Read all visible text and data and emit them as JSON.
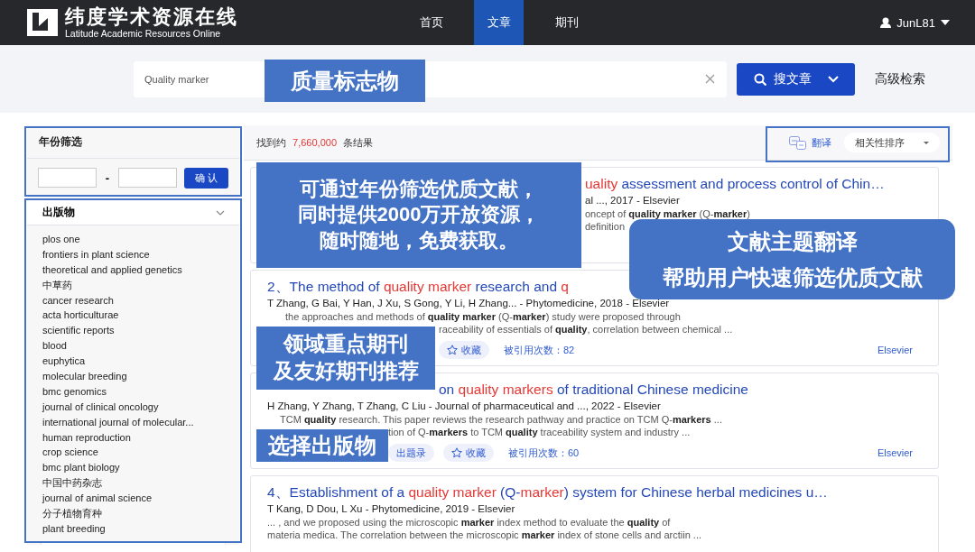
{
  "header": {
    "logo_title": "纬度学术资源在线",
    "logo_subtitle": "Latitude Academic Resources Online",
    "nav": [
      {
        "label": "首页",
        "selected": false
      },
      {
        "label": "文章",
        "selected": true
      },
      {
        "label": "期刊",
        "selected": false
      }
    ],
    "user": "JunL81"
  },
  "search": {
    "query": "Quality marker",
    "button": "搜文章",
    "advanced": "高级检索"
  },
  "year_filter": {
    "title": "年份筛选",
    "separator": "-",
    "button": "确 认"
  },
  "publications": {
    "title": "出版物",
    "items": [
      "plos one",
      "frontiers in plant science",
      "theoretical and applied genetics",
      "中草药",
      "cancer research",
      "acta horticulturae",
      "scientific reports",
      "blood",
      "euphytica",
      "molecular breeding",
      "bmc genomics",
      "journal of clinical oncology",
      "international journal of molecular...",
      "human reproduction",
      "crop science",
      "bmc plant biology",
      "中国中药杂志",
      "journal of animal science",
      "分子植物育种",
      "plant breeding"
    ]
  },
  "results": {
    "count_prefix": "找到约",
    "count": "7,660,000",
    "count_suffix": "条结果",
    "translate": "翻译",
    "sort": "相关性排序",
    "items": [
      {
        "title": [
          {
            "text": "uality",
            "highlight": true
          },
          {
            "text": " assessment and process control of Chin…",
            "highlight": false
          }
        ],
        "meta": "al ..., 2017 - Elsevier",
        "abstract": [
          "oncept of **quality marker** (Q-**marker**)",
          "definition"
        ]
      },
      {
        "title": [
          {
            "text": "2、The method of ",
            "highlight": false
          },
          {
            "text": "quality marker",
            "highlight": true
          },
          {
            "text": " research and ",
            "highlight": false
          },
          {
            "text": "q",
            "highlight": true
          }
        ],
        "meta": "T Zhang, G Bai, Y Han, J Xu, S Gong, Y Li, H Zhang... - Phytomedicine, 2018 - Elsevier",
        "abstract": [
          "the approaches and methods of **quality marker** (Q-**marker**) study were proposed through",
          "raceability of essentials of **quality**, correlation between chemical ..."
        ],
        "actions": [
          {
            "kind": "favorite",
            "label": "收藏"
          }
        ],
        "citations": "被引用次数：82",
        "publisher": "Elsevier"
      },
      {
        "title": [
          {
            "text": "on ",
            "highlight": false
          },
          {
            "text": "quality markers",
            "highlight": true
          },
          {
            "text": " of traditional Chinese medicine",
            "highlight": false
          }
        ],
        "meta": "H Zhang, Y Zhang, T Zhang, C Liu - Journal of pharmaceutical and ..., 2022 - Elsevier",
        "abstract": [
          "TCM **quality** research. This paper reviews the research pathway and practice on TCM Q-**markers** ...",
          "tion of Q-**markers** to TCM **quality** traceability system and industry ..."
        ],
        "actions": [
          {
            "kind": "export",
            "label": "出题录"
          },
          {
            "kind": "favorite",
            "label": "收藏"
          }
        ],
        "citations": "被引用次数：60",
        "publisher": "Elsevier"
      },
      {
        "title": [
          {
            "text": "4、Establishment of a ",
            "highlight": false
          },
          {
            "text": "quality marker",
            "highlight": true
          },
          {
            "text": " (Q-",
            "highlight": false
          },
          {
            "text": "marker",
            "highlight": true
          },
          {
            "text": ") system for Chinese herbal medicines u…",
            "highlight": false
          }
        ],
        "meta": "T Kang, D Dou, L Xu - Phytomedicine, 2019 - Elsevier",
        "abstract": [
          "... , and we proposed using the microscopic **marker** index method to evaluate the **quality** of",
          "materia medica. The correlation between the microscopic **marker** index of stone cells and arctiin ..."
        ]
      }
    ]
  },
  "callouts": [
    {
      "lines": [
        "质量标志物"
      ]
    },
    {
      "lines": [
        "可通过年份筛选优质文献，",
        "同时提供2000万开放资源，",
        "随时随地，免费获取。"
      ]
    },
    {
      "lines": [
        "文献主题翻译",
        "帮助用户快速筛选优质文献"
      ]
    },
    {
      "lines": [
        "领域重点期刊",
        "及友好期刊推荐"
      ]
    },
    {
      "lines": [
        "选择出版物"
      ]
    }
  ]
}
